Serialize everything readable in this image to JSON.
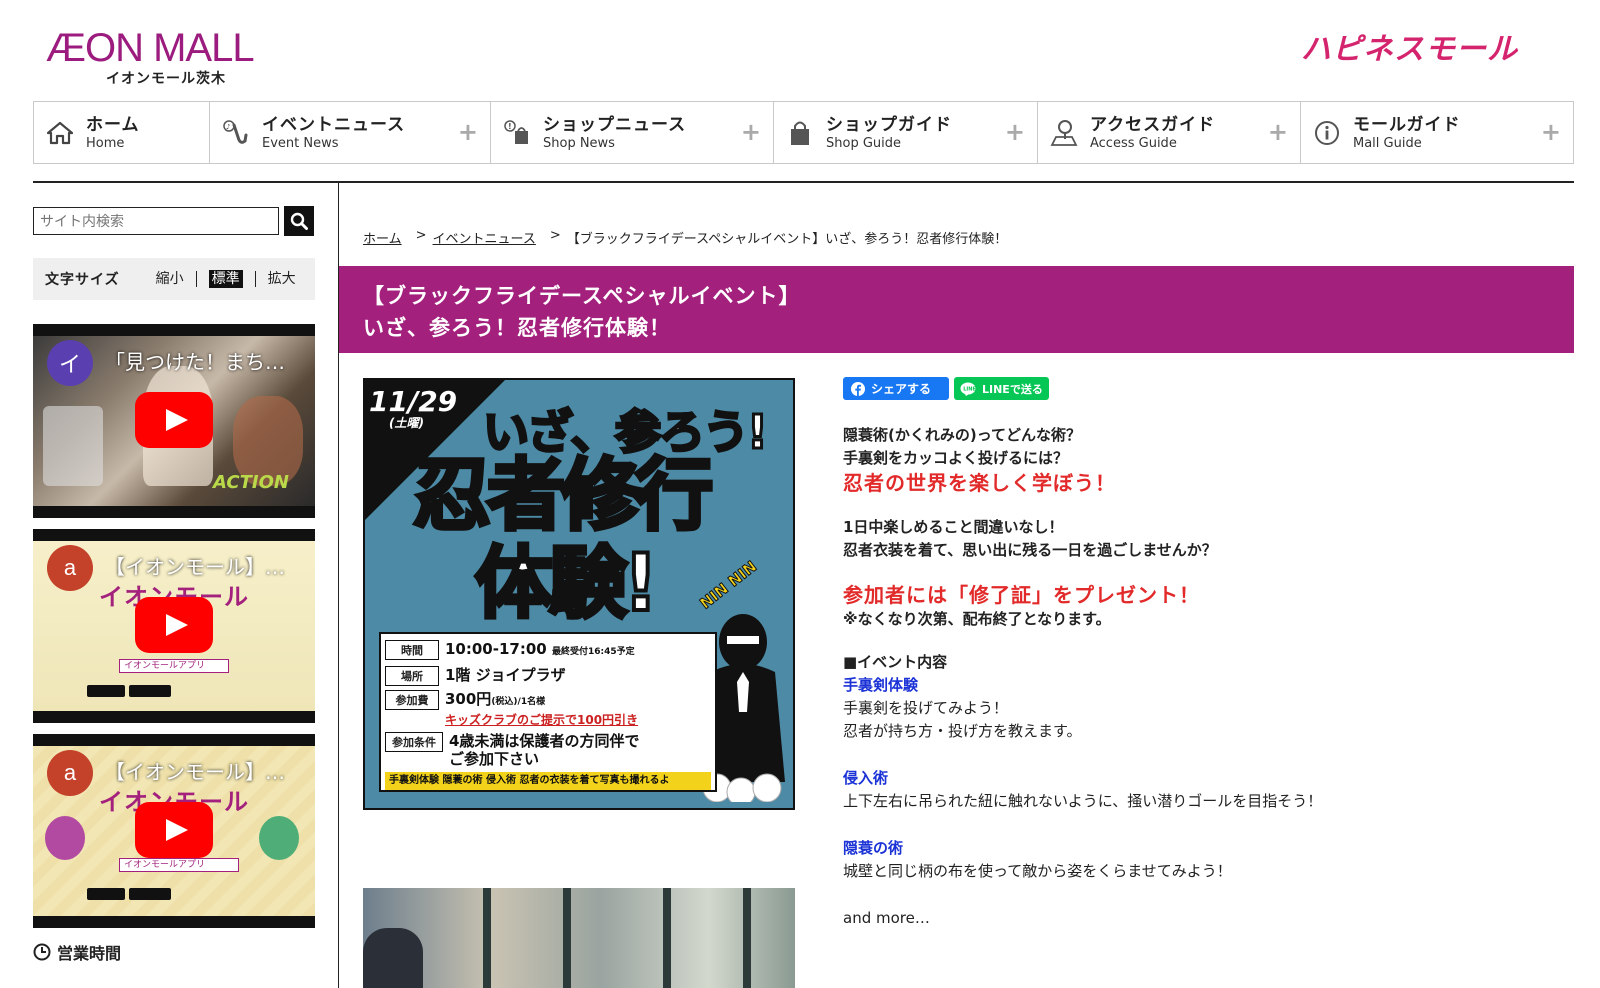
{
  "header": {
    "brand_main": "ÆON MALL",
    "brand_sub": "イオンモール茨木",
    "happy_logo": "ハピネスモール"
  },
  "nav": [
    {
      "jp": "ホーム",
      "en": "Home",
      "icon": "home-icon",
      "plus": ""
    },
    {
      "jp": "イベントニュース",
      "en": "Event News",
      "icon": "saxophone-icon",
      "plus": "+"
    },
    {
      "jp": "ショップニュース",
      "en": "Shop News",
      "icon": "shopping-bag-tag-icon",
      "plus": "+"
    },
    {
      "jp": "ショップガイド",
      "en": "Shop Guide",
      "icon": "shopping-bag-icon",
      "plus": "+"
    },
    {
      "jp": "アクセスガイド",
      "en": "Access Guide",
      "icon": "map-pin-icon",
      "plus": "+"
    },
    {
      "jp": "モールガイド",
      "en": "Mall Guide",
      "icon": "info-icon",
      "plus": "+"
    }
  ],
  "sidebar": {
    "search_placeholder": "サイト内検索",
    "fontsize": {
      "label": "文字サイズ",
      "small": "縮小",
      "normal": "標準",
      "large": "拡大"
    },
    "videos": [
      {
        "avatar": "イ",
        "avatar_color": "#5a3fb0",
        "title": "「見つけた！まち…"
      },
      {
        "avatar": "a",
        "avatar_color": "#c4412a",
        "title": "【イオンモール】…"
      },
      {
        "avatar": "a",
        "avatar_color": "#c4412a",
        "title": "【イオンモール】…"
      }
    ],
    "hours_label": "営業時間"
  },
  "breadcrumb": {
    "home": "ホーム",
    "sep1": ">",
    "event_news": "イベントニュース",
    "sep2": ">",
    "current": "【ブラックフライデースペシャルイベント】いざ、参ろう！忍者修行体験！"
  },
  "title": {
    "line1": "【ブラックフライデースペシャルイベント】",
    "line2": "いざ、参ろう！忍者修行体験！"
  },
  "poster": {
    "date": "11/29",
    "weekday": "(土曜)",
    "headline1": "いざ、参ろう!",
    "headline2": "忍者修行",
    "headline3": "体験!",
    "ninnin": "NIN NIN",
    "rows": [
      {
        "tag": "時間",
        "value": "10:00-17:00",
        "note": "最終受付16:45予定"
      },
      {
        "tag": "場所",
        "value": "1階 ジョイプラザ"
      },
      {
        "tag": "参加費",
        "value": "300円",
        "note": "(税込)/1名様",
        "red": "キッズクラブのご提示で100円引き"
      },
      {
        "tag": "参加条件",
        "value": "4歳未満は保護者の方同伴で",
        "value2": "ご参加下さい"
      }
    ],
    "strip": "手裏剣体験 隠蓑の術 侵入術 忍者の衣装を着て写真も撮れるよ"
  },
  "share": {
    "facebook": "シェアする",
    "line": "LINEで送る"
  },
  "article": {
    "q1": "隠蓑術(かくれみの)ってどんな術？",
    "q2": "手裏剣をカッコよく投げるには？",
    "lead": "忍者の世界を楽しく学ぼう！",
    "p1": "1日中楽しめること間違いなし！",
    "p2": "忍者衣装を着て、思い出に残る一日を過ごしませんか？",
    "gift": "参加者には「修了証」をプレゼント！",
    "gift_note": "※なくなり次第、配布終了となります。",
    "section": "■イベント内容",
    "e1_title": "手裏剣体験",
    "e1_l1": "手裏剣を投げてみよう！",
    "e1_l2": "忍者が持ち方・投げ方を教えます。",
    "e2_title": "侵入術",
    "e2_l1": "上下左右に吊られた紐に触れないように、掻い潜りゴールを目指そう！",
    "e3_title": "隠蓑の術",
    "e3_l1": "城壁と同じ柄の布を使って敵から姿をくらませてみよう！",
    "more": "and more…"
  }
}
